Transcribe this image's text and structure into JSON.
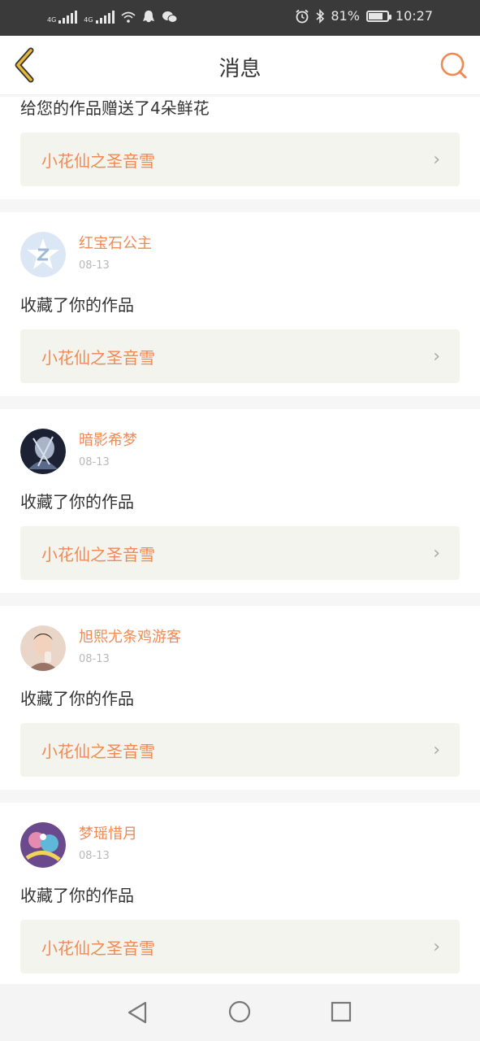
{
  "status_bar": {
    "net1": "4G",
    "net2": "4G",
    "battery_percent": "81%",
    "battery_level": 0.81,
    "time": "10:27"
  },
  "header": {
    "title": "消息"
  },
  "first_message": {
    "text": "给您的作品赠送了4朵鲜花",
    "work_title": "小花仙之圣音雪"
  },
  "messages": [
    {
      "user": "红宝石公主",
      "date": "08-13",
      "text": "收藏了你的作品",
      "work_title": "小花仙之圣音雪",
      "avatar": "z-logo-avatar"
    },
    {
      "user": "暗影希梦",
      "date": "08-13",
      "text": "收藏了你的作品",
      "work_title": "小花仙之圣音雪",
      "avatar": "anime-dark-avatar"
    },
    {
      "user": "旭熙尤条鸡游客",
      "date": "08-13",
      "text": "收藏了你的作品",
      "work_title": "小花仙之圣音雪",
      "avatar": "photo-person-avatar"
    },
    {
      "user": "梦瑶惜月",
      "date": "08-13",
      "text": "收藏了你的作品",
      "work_title": "小花仙之圣音雪",
      "avatar": "anime-colorful-avatar"
    }
  ],
  "colors": {
    "accent": "#ef8a55",
    "back_arrow": "#e8b838",
    "link_bg": "#f4f4ee"
  },
  "icons": {
    "back": "chevron-left-icon",
    "search": "search-icon",
    "nav_back": "triangle-back-icon",
    "nav_home": "circle-home-icon",
    "nav_recent": "square-recent-icon"
  }
}
